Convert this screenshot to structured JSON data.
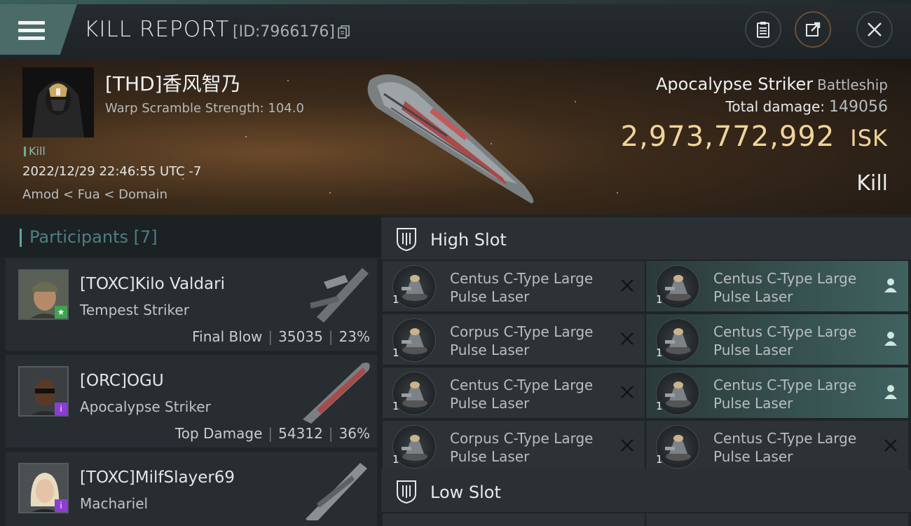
{
  "header": {
    "title": "KILL REPORT",
    "report_id": "[ID:7966176]"
  },
  "victim": {
    "name": "[THD]香风智乃",
    "warp_scramble": "Warp Scramble Strength: 104.0",
    "tag": "Kill",
    "datetime": "2022/12/29 22:46:55 UTC -7",
    "location": "Amod < Fua < Domain",
    "ship": "Apocalypse Striker",
    "ship_class": "Battleship",
    "total_damage_label": "Total damage:",
    "total_damage": "149056",
    "isk_value": "2,973,772,992",
    "isk_unit": "ISK",
    "result": "Kill"
  },
  "participants": {
    "title": "Participants [7]",
    "list": [
      {
        "name": "[TOXC]Kilo Valdari",
        "ship": "Tempest Striker",
        "label": "Final Blow",
        "damage": "35035",
        "percent": "23%",
        "badge": "★",
        "badge_color": "#3fa34d"
      },
      {
        "name": "[ORC]OGU",
        "ship": "Apocalypse Striker",
        "label": "Top Damage",
        "damage": "54312",
        "percent": "36%",
        "badge": "i",
        "badge_color": "#8b3fd1"
      },
      {
        "name": "[TOXC]MilfSlayer69",
        "ship": "Machariel",
        "label": "",
        "damage": "",
        "percent": "",
        "badge": "i",
        "badge_color": "#8b3fd1"
      }
    ]
  },
  "slots": {
    "high_title": "High Slot",
    "low_title": "Low Slot",
    "high_items": [
      {
        "line1": "Centus C-Type Large",
        "line2": "Pulse Laser",
        "qty": "1",
        "action": "close",
        "fitted": false
      },
      {
        "line1": "Centus C-Type Large",
        "line2": "Pulse Laser",
        "qty": "1",
        "action": "person",
        "fitted": true
      },
      {
        "line1": "Corpus C-Type Large",
        "line2": "Pulse Laser",
        "qty": "1",
        "action": "close",
        "fitted": false
      },
      {
        "line1": "Centus C-Type Large",
        "line2": "Pulse Laser",
        "qty": "1",
        "action": "person",
        "fitted": true
      },
      {
        "line1": "Centus C-Type Large",
        "line2": "Pulse Laser",
        "qty": "1",
        "action": "close",
        "fitted": false
      },
      {
        "line1": "Centus C-Type Large",
        "line2": "Pulse Laser",
        "qty": "1",
        "action": "person",
        "fitted": true
      },
      {
        "line1": "Corpus C-Type Large",
        "line2": "Pulse Laser",
        "qty": "1",
        "action": "close",
        "fitted": false
      },
      {
        "line1": "Centus C-Type Large",
        "line2": "Pulse Laser",
        "qty": "1",
        "action": "close",
        "fitted": false
      }
    ]
  },
  "icons": {
    "menu": "hamburger-icon",
    "copy": "copy-icon",
    "clipboard": "clipboard-icon",
    "share": "share-icon",
    "close": "close-icon",
    "slot": "slot-icon"
  },
  "colors": {
    "accent_teal": "#4b6b69",
    "isk_gold": "#f0d49a",
    "fitted_row": "#3f625f"
  }
}
